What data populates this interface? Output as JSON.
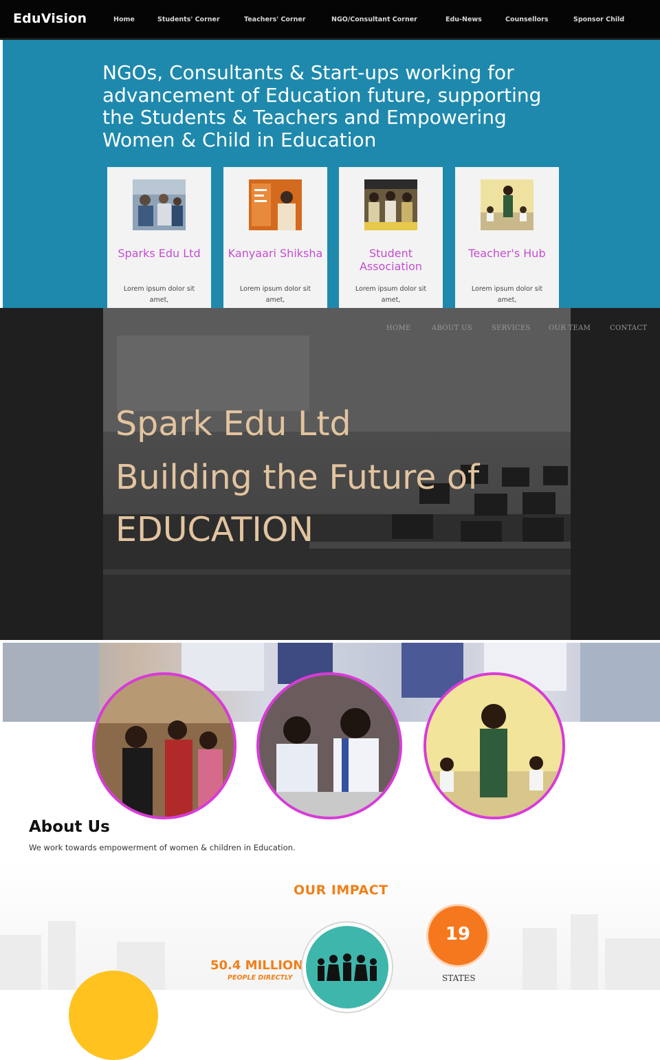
{
  "topnav": {
    "brand": "EduVision",
    "items": [
      "Home",
      "Students' Corner",
      "Teachers' Corner",
      "NGO/Consultant Corner",
      "Edu-News",
      "Counsellors",
      "Sponsor Child"
    ]
  },
  "hero": {
    "title": "NGOs, Consultants & Start-ups working for advancement of Education future, supporting the Students & Teachers and Empowering Women & Child in Education",
    "cards": [
      {
        "title": "Sparks Edu Ltd",
        "desc": "Lorem ipsum dolor sit amet,"
      },
      {
        "title": "Kanyaari Shiksha",
        "desc": "Lorem ipsum dolor sit amet,"
      },
      {
        "title": "Student Association",
        "desc": "Lorem ipsum dolor sit amet,"
      },
      {
        "title": "Teacher's Hub",
        "desc": "Lorem ipsum dolor sit amet,"
      }
    ]
  },
  "dark_section": {
    "nav": [
      "HOME",
      "ABOUT US",
      "SERVICES",
      "OUR TEAM",
      "CONTACT"
    ],
    "line1": "Spark Edu Ltd",
    "line2": "Building the Future of",
    "line3": "EDUCATION"
  },
  "about": {
    "title": "About Us",
    "text": "We work towards empowerment of women & children in Education."
  },
  "impact": {
    "title": "OUR IMPACT",
    "people_value": "50.4 MILLION",
    "people_sub": "PEOPLE DIRECTLY",
    "states_value": "19",
    "states_label": "STATES"
  },
  "colors": {
    "hero_blue": "#1e89ad",
    "card_title": "#c44dd0",
    "dark_headline": "#e2c49f",
    "circle_border": "#d83bd8",
    "impact_orange": "#f07f18",
    "impact_teal": "#3fb6ac"
  }
}
